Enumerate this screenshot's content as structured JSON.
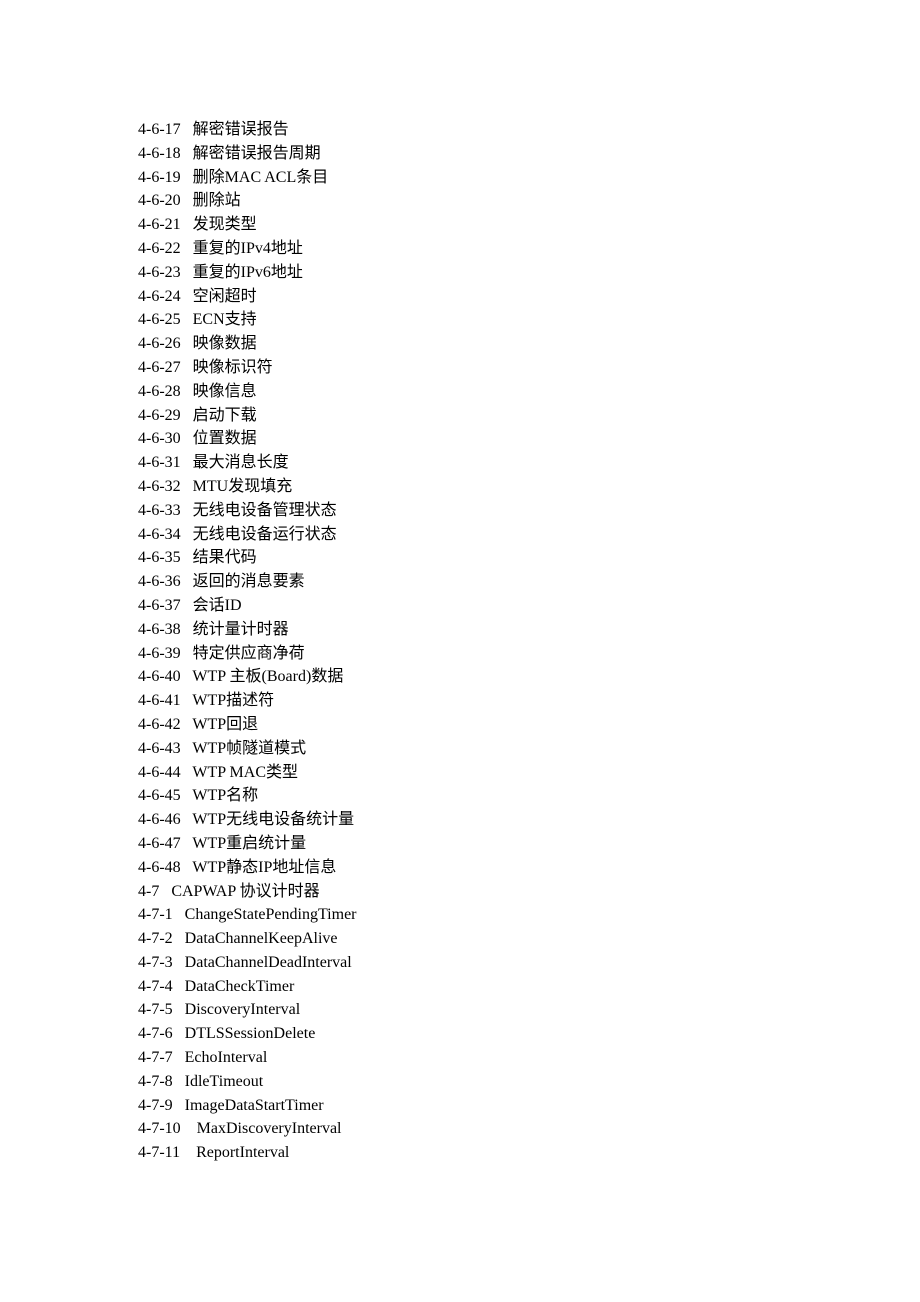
{
  "entries": [
    {
      "num": "4-6-17",
      "gap": "   ",
      "title": "解密错误报告"
    },
    {
      "num": "4-6-18",
      "gap": "   ",
      "title": "解密错误报告周期"
    },
    {
      "num": "4-6-19",
      "gap": "   ",
      "title": "删除MAC ACL条目"
    },
    {
      "num": "4-6-20",
      "gap": "   ",
      "title": "删除站"
    },
    {
      "num": "4-6-21",
      "gap": "   ",
      "title": "发现类型"
    },
    {
      "num": "4-6-22",
      "gap": "   ",
      "title": "重复的IPv4地址"
    },
    {
      "num": "4-6-23",
      "gap": "   ",
      "title": "重复的IPv6地址"
    },
    {
      "num": "4-6-24",
      "gap": "   ",
      "title": "空闲超时"
    },
    {
      "num": "4-6-25",
      "gap": "   ",
      "title": "ECN支持"
    },
    {
      "num": "4-6-26",
      "gap": "   ",
      "title": "映像数据"
    },
    {
      "num": "4-6-27",
      "gap": "   ",
      "title": "映像标识符"
    },
    {
      "num": "4-6-28",
      "gap": "   ",
      "title": "映像信息"
    },
    {
      "num": "4-6-29",
      "gap": "   ",
      "title": "启动下载"
    },
    {
      "num": "4-6-30",
      "gap": "   ",
      "title": "位置数据"
    },
    {
      "num": "4-6-31",
      "gap": "   ",
      "title": "最大消息长度"
    },
    {
      "num": "4-6-32",
      "gap": "   ",
      "title": "MTU发现填充"
    },
    {
      "num": "4-6-33",
      "gap": "   ",
      "title": "无线电设备管理状态"
    },
    {
      "num": "4-6-34",
      "gap": "   ",
      "title": "无线电设备运行状态"
    },
    {
      "num": "4-6-35",
      "gap": "   ",
      "title": "结果代码"
    },
    {
      "num": "4-6-36",
      "gap": "   ",
      "title": "返回的消息要素"
    },
    {
      "num": "4-6-37",
      "gap": "   ",
      "title": "会话ID"
    },
    {
      "num": "4-6-38",
      "gap": "   ",
      "title": "统计量计时器"
    },
    {
      "num": "4-6-39",
      "gap": "   ",
      "title": "特定供应商净荷"
    },
    {
      "num": "4-6-40",
      "gap": "   ",
      "title": "WTP 主板(Board)数据"
    },
    {
      "num": "4-6-41",
      "gap": "   ",
      "title": "WTP描述符"
    },
    {
      "num": "4-6-42",
      "gap": "   ",
      "title": "WTP回退"
    },
    {
      "num": "4-6-43",
      "gap": "   ",
      "title": "WTP帧隧道模式"
    },
    {
      "num": "4-6-44",
      "gap": "   ",
      "title": "WTP MAC类型"
    },
    {
      "num": "4-6-45",
      "gap": "   ",
      "title": "WTP名称"
    },
    {
      "num": "4-6-46",
      "gap": "   ",
      "title": "WTP无线电设备统计量"
    },
    {
      "num": "4-6-47",
      "gap": "   ",
      "title": "WTP重启统计量"
    },
    {
      "num": "4-6-48",
      "gap": "   ",
      "title": "WTP静态IP地址信息"
    },
    {
      "num": "4-7",
      "gap": "   ",
      "title": "CAPWAP 协议计时器"
    },
    {
      "num": "4-7-1",
      "gap": "   ",
      "title": "ChangeStatePendingTimer"
    },
    {
      "num": "4-7-2",
      "gap": "   ",
      "title": "DataChannelKeepAlive"
    },
    {
      "num": "4-7-3",
      "gap": "   ",
      "title": "DataChannelDeadInterval"
    },
    {
      "num": "4-7-4",
      "gap": "   ",
      "title": "DataCheckTimer"
    },
    {
      "num": "4-7-5",
      "gap": "   ",
      "title": "DiscoveryInterval"
    },
    {
      "num": "4-7-6",
      "gap": "   ",
      "title": "DTLSSessionDelete"
    },
    {
      "num": "4-7-7",
      "gap": "   ",
      "title": "EchoInterval"
    },
    {
      "num": "4-7-8",
      "gap": "   ",
      "title": "IdleTimeout"
    },
    {
      "num": "4-7-9",
      "gap": "   ",
      "title": "ImageDataStartTimer"
    },
    {
      "num": "4-7-10",
      "gap": "    ",
      "title": "MaxDiscoveryInterval"
    },
    {
      "num": "4-7-11",
      "gap": "    ",
      "title": "ReportInterval"
    }
  ]
}
